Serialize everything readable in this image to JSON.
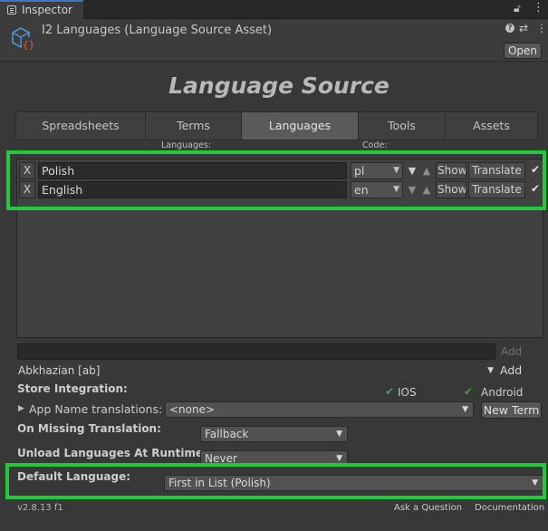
{
  "window": {
    "tab_label": "Inspector",
    "lock_icon": "lock-icon",
    "menu_icon": "more-vertical-icon"
  },
  "header": {
    "title": "I2 Languages (Language Source Asset)",
    "asset_icon": "cube-icon",
    "open_label": "Open"
  },
  "main": {
    "title": "Language Source",
    "tabs": [
      {
        "label": "Spreadsheets",
        "active": false
      },
      {
        "label": "Terms",
        "active": false
      },
      {
        "label": "Languages",
        "active": true
      },
      {
        "label": "Tools",
        "active": false
      },
      {
        "label": "Assets",
        "active": false
      }
    ],
    "columns": {
      "languages": "Languages:",
      "code": "Code:"
    },
    "languages": [
      {
        "remove": "X",
        "name": "Polish",
        "code": "pl",
        "show": "Show",
        "translate": "Translate",
        "enabled": true
      },
      {
        "remove": "X",
        "name": "English",
        "code": "en",
        "show": "Show",
        "translate": "Translate",
        "enabled": true
      }
    ],
    "add_input_value": "",
    "add_disabled_label": "Add",
    "language_select_value": "Abkhazian [ab]",
    "add_label": "Add"
  },
  "store": {
    "label": "Store Integration:",
    "ios_label": "IOS",
    "android_label": "Android",
    "app_name_label": "App Name translations:",
    "app_name_value": "<none>",
    "new_term_label": "New Term"
  },
  "settings": {
    "missing_label": "On Missing Translation:",
    "missing_value": "Fallback",
    "unload_label": "Unload Languages At Runtime:",
    "unload_value": "Never",
    "default_label": "Default Language:",
    "default_value": "First in List (Polish)"
  },
  "footer": {
    "version": "v2.8.13 f1",
    "ask": "Ask a Question",
    "documentation": "Documentation"
  },
  "colors": {
    "highlight": "#22c93b",
    "check": "#4f9a4a",
    "active_tab": "#5a5a5a"
  }
}
